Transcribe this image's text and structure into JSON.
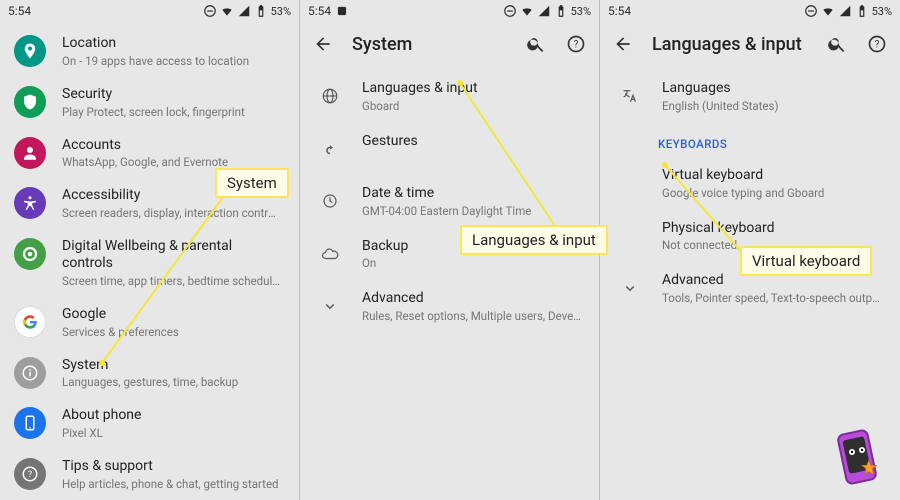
{
  "statusbar": {
    "time": "5:54",
    "battery": "53%"
  },
  "callout": {
    "system": "System",
    "langinput": "Languages & input",
    "vkeyboard": "Virtual keyboard"
  },
  "screen1": {
    "items": {
      "location": {
        "title": "Location",
        "sub": "On - 19 apps have access to location"
      },
      "security": {
        "title": "Security",
        "sub": "Play Protect, screen lock, fingerprint"
      },
      "accounts": {
        "title": "Accounts",
        "sub": "WhatsApp, Google, and Evernote"
      },
      "a11y": {
        "title": "Accessibility",
        "sub": "Screen readers, display, interaction controls"
      },
      "wellbeing": {
        "title": "Digital Wellbeing & parental controls",
        "sub": "Screen time, app timers, bedtime schedules"
      },
      "google": {
        "title": "Google",
        "sub": "Services & preferences"
      },
      "system": {
        "title": "System",
        "sub": "Languages, gestures, time, backup"
      },
      "about": {
        "title": "About phone",
        "sub": "Pixel XL"
      },
      "tips": {
        "title": "Tips & support",
        "sub": "Help articles, phone & chat, getting started"
      }
    }
  },
  "screen2": {
    "title": "System",
    "items": {
      "lang": {
        "title": "Languages & input",
        "sub": "Gboard"
      },
      "gest": {
        "title": "Gestures",
        "sub": ""
      },
      "date": {
        "title": "Date & time",
        "sub": "GMT-04:00 Eastern Daylight Time"
      },
      "backup": {
        "title": "Backup",
        "sub": "On"
      },
      "adv": {
        "title": "Advanced",
        "sub": "Rules, Reset options, Multiple users, Developer opti…"
      }
    }
  },
  "screen3": {
    "title": "Languages & input",
    "section_keyboards": "KEYBOARDS",
    "items": {
      "lang": {
        "title": "Languages",
        "sub": "English (United States)"
      },
      "vkbd": {
        "title": "Virtual keyboard",
        "sub": "Google voice typing and Gboard"
      },
      "pkbd": {
        "title": "Physical keyboard",
        "sub": "Not connected"
      },
      "adv": {
        "title": "Advanced",
        "sub": "Tools, Pointer speed, Text-to-speech output"
      }
    }
  }
}
